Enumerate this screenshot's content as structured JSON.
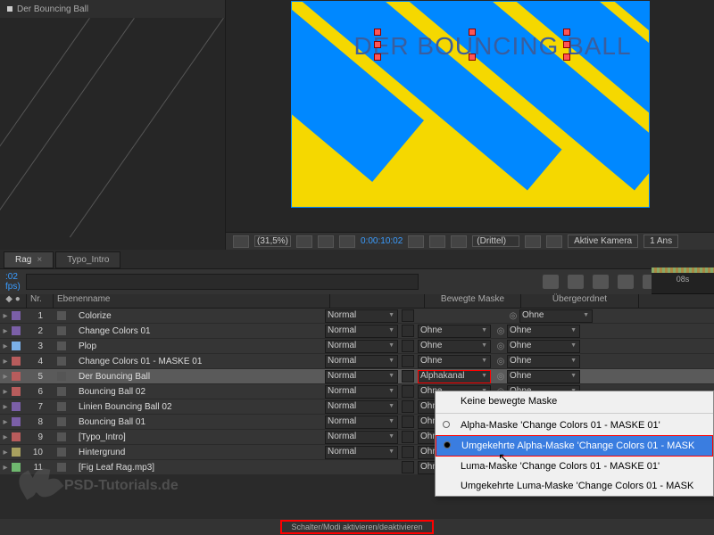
{
  "top_tab": {
    "label": "Der Bouncing Ball"
  },
  "canvas": {
    "title_text": "DER BOUNCING BALL"
  },
  "viewer_controls": {
    "zoom": "(31,5%)",
    "timecode": "0:00:10:02",
    "quality": "(Drittel)",
    "camera": "Aktive Kamera",
    "views": "1 Ans"
  },
  "timeline_tabs": {
    "active": "Rag",
    "close_x": "×",
    "second": "Typo_Intro"
  },
  "timeline_header": {
    "time": ":02",
    "fps": "fps)",
    "ruler_label": "08s"
  },
  "search": {
    "placeholder": ""
  },
  "columns": {
    "nr": "Nr.",
    "name": "Ebenenname",
    "trkmat": "Bewegte Maske",
    "parent": "Übergeordnet"
  },
  "mode_normal": "Normal",
  "trk_none": "Ohne",
  "trk_alpha": "Alphakanal",
  "parent_none": "Ohne",
  "layers": [
    {
      "nr": "1",
      "name": "Colorize",
      "color": "#7b5fa8",
      "type": "adjustment"
    },
    {
      "nr": "2",
      "name": "Change Colors 01",
      "color": "#7b5fa8",
      "type": "adjustment"
    },
    {
      "nr": "3",
      "name": "Plop",
      "color": "#7bb0e8",
      "type": "solid"
    },
    {
      "nr": "4",
      "name": "Change Colors 01 - MASKE 01",
      "color": "#b85c5c",
      "type": "adjustment"
    },
    {
      "nr": "5",
      "name": "Der Bouncing Ball",
      "color": "#b85c5c",
      "type": "text",
      "selected": true,
      "trk": "alpha"
    },
    {
      "nr": "6",
      "name": "Bouncing Ball 02",
      "color": "#b85c5c",
      "type": "solid"
    },
    {
      "nr": "7",
      "name": "Linien Bouncing Ball 02",
      "color": "#7b5fa8",
      "type": "solid"
    },
    {
      "nr": "8",
      "name": "Bouncing Ball 01",
      "color": "#7b5fa8",
      "type": "solid"
    },
    {
      "nr": "9",
      "name": "[Typo_Intro]",
      "color": "#b85c5c",
      "type": "comp"
    },
    {
      "nr": "10",
      "name": "Hintergrund",
      "color": "#a8a05f",
      "type": "solid"
    },
    {
      "nr": "11",
      "name": "[Fig Leaf Rag.mp3]",
      "color": "#6fb86f",
      "type": "audio"
    }
  ],
  "dropdown": {
    "items": [
      "Keine bewegte Maske",
      "Alpha-Maske 'Change Colors 01 - MASKE 01'",
      "Umgekehrte Alpha-Maske 'Change Colors 01 - MASK",
      "Luma-Maske 'Change Colors 01 - MASKE 01'",
      "Umgekehrte Luma-Maske 'Change Colors 01 - MASK"
    ],
    "selected_index": 2
  },
  "watermark": "PSD-Tutorials.de",
  "status_button": "Schalter/Modi aktivieren/deaktivieren"
}
